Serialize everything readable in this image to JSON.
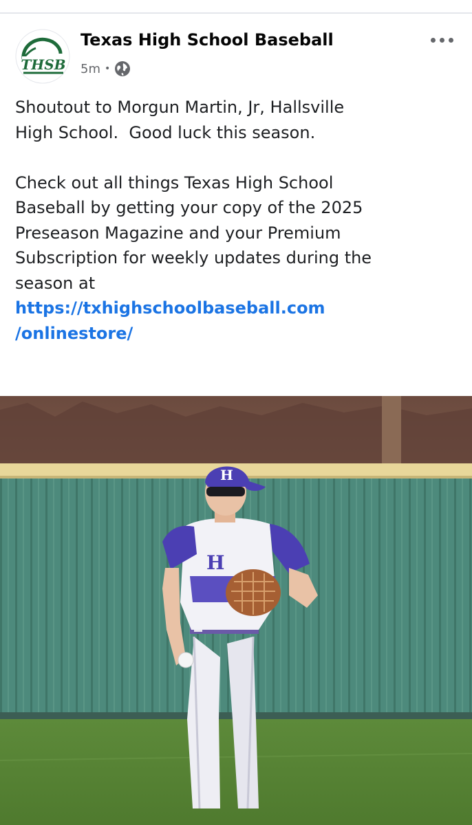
{
  "post": {
    "page_name": "Texas High School Baseball",
    "timestamp": "5m",
    "meta_separator": "•",
    "visibility_icon": "globe-icon",
    "more_icon": "more-horizontal-icon",
    "avatar": {
      "logo_text": "THSB",
      "brand_color": "#1e6b3a"
    },
    "body": {
      "paragraph_1_line_1": "Shoutout to Morgun Martin, Jr, Hallsville",
      "paragraph_1_line_2": "High School.  Good luck this season.",
      "paragraph_2_line_1": "Check out all things Texas High School",
      "paragraph_2_line_2": "Baseball by getting your copy of the 2025",
      "paragraph_2_line_3": "Preseason Magazine and your Premium",
      "paragraph_2_line_4": "Subscription for weekly updates during the",
      "paragraph_2_line_5": "season at",
      "link_line_1": "https://txhighschoolbaseball.com",
      "link_line_2": "/onlinestore/"
    },
    "photo": {
      "cap_letter": "H",
      "jersey_letter": "H"
    }
  },
  "colors": {
    "link": "#1b74e4",
    "text": "#1c1e21",
    "muted": "#65676b",
    "fence": "#4a8a7c",
    "team_purple": "#4b3fb3"
  }
}
